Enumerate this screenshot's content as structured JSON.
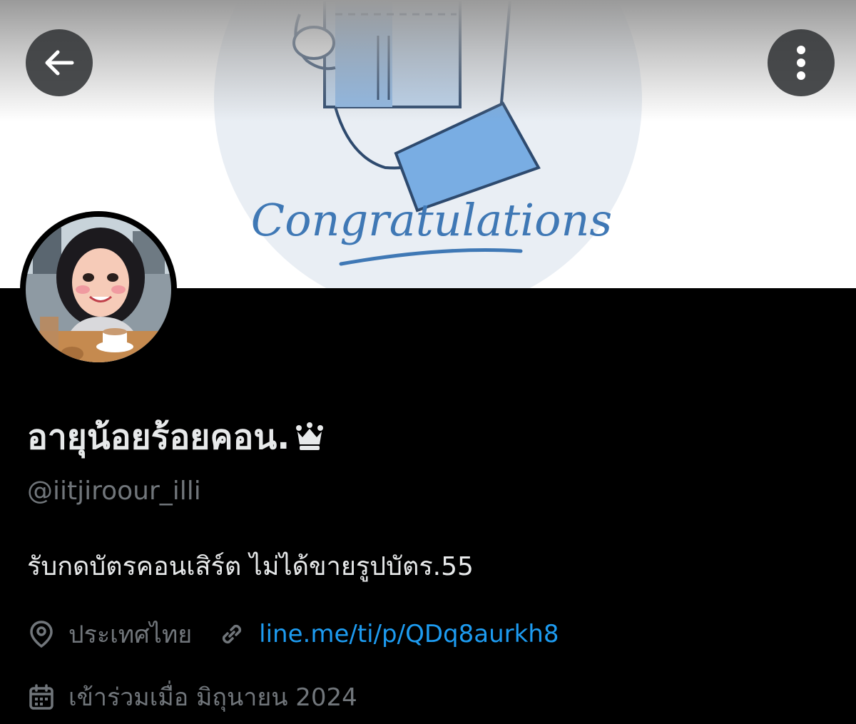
{
  "header": {
    "back_icon": "arrow-left-icon",
    "more_icon": "more-vertical-icon",
    "banner_text": "Congratulations"
  },
  "profile": {
    "display_name": "อายุน้อยร้อยคอน.",
    "name_badge_icon": "crown-icon",
    "handle": "@iitjiroour_illi",
    "bio": "รับกดบัตรคอนเสิร์ต ไม่ได้ขายรูปบัตร.55",
    "location": "ประเทศไทย",
    "location_icon": "location-pin-icon",
    "link": "line.me/ti/p/QDq8aurkh8",
    "link_icon": "link-icon",
    "joined": "เข้าร่วมเมื่อ มิถุนายน 2024",
    "joined_icon": "calendar-icon"
  },
  "colors": {
    "background": "#000000",
    "accent_link": "#1d9bf0",
    "text_primary": "#e7e9ea",
    "text_secondary": "#71767b",
    "banner_blue": "#3f78b5"
  }
}
